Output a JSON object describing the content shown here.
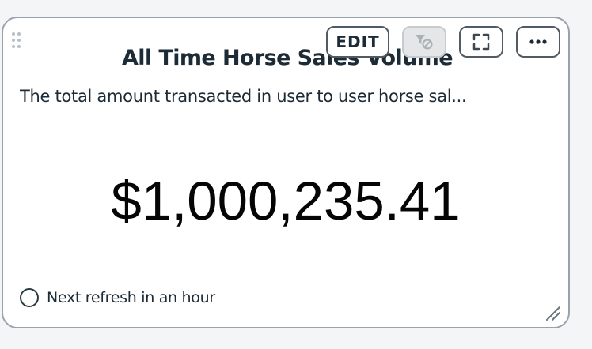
{
  "card": {
    "title": "All Time Horse Sales Volume",
    "subtitle": "The total amount transacted in user to user horse sal...",
    "value": "$1,000,235.41",
    "refresh_text": "Next refresh in an hour"
  },
  "toolbar": {
    "edit_label": "EDIT",
    "filter_icon": "filter-off-icon",
    "expand_icon": "fullscreen-icon",
    "more_icon": "more-horizontal-icon"
  },
  "colors": {
    "text": "#1d2b36",
    "value": "#050505",
    "border": "#9aa3ab",
    "button_border": "#505b64",
    "disabled_button_bg": "#e4e6e8"
  }
}
